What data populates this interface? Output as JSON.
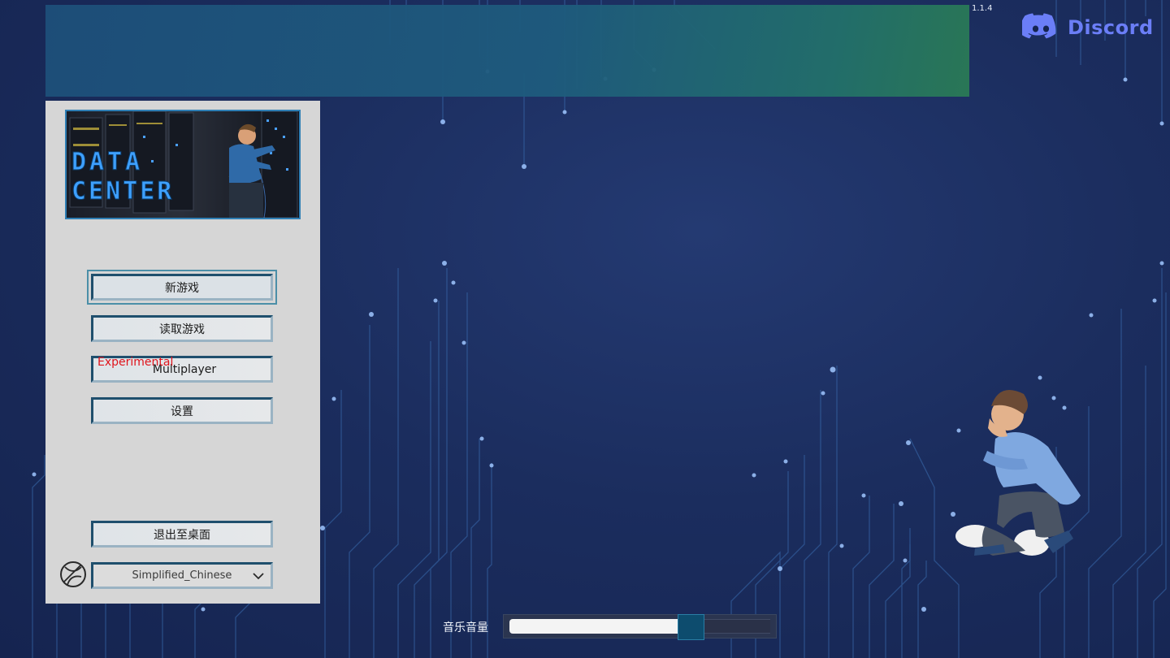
{
  "app": {
    "version": "1.1.4",
    "discord_label": "Discord"
  },
  "logo": {
    "line1": "DATA",
    "line2": "CENTER"
  },
  "menu": {
    "new_game": "新游戏",
    "load_game": "读取游戏",
    "multiplayer_badge": "Experimental",
    "multiplayer": "Multiplayer",
    "settings": "设置",
    "quit": "退出至桌面",
    "language": "Simplified_Chinese"
  },
  "audio": {
    "music_volume_label": "音乐音量",
    "music_volume": 0.72
  },
  "colors": {
    "background": "#1b2d5e",
    "panel": "#d6d6d6",
    "button_border": "#1f4f6d",
    "experimental": "#e0141c",
    "discord": "#6b7ef7",
    "slider_handle": "#0d4c6e"
  },
  "icons": {
    "discord": "discord-icon",
    "language": "globe-icon",
    "dropdown": "chevron-down-icon"
  }
}
